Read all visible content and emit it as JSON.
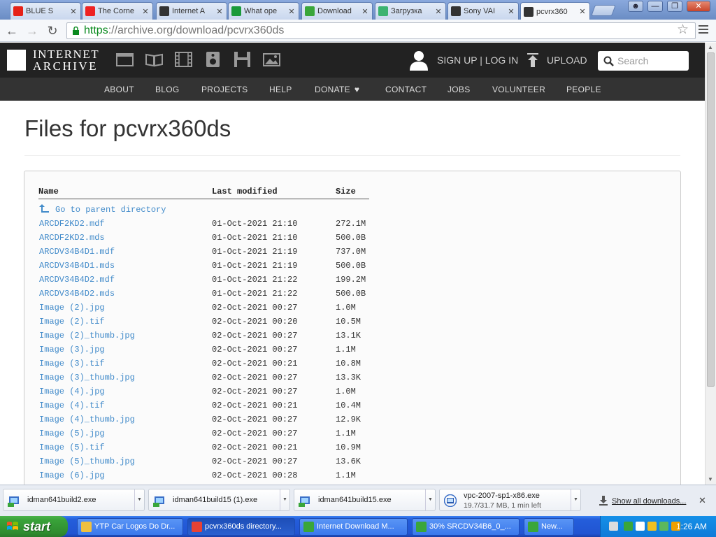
{
  "browser": {
    "tabs": [
      {
        "title": "BLUE S",
        "icon": "youtube-icon",
        "color": "#e62117"
      },
      {
        "title": "The Corne",
        "icon": "red-diamond-icon",
        "color": "#e22"
      },
      {
        "title": "Internet A",
        "icon": "archive-icon",
        "color": "#333"
      },
      {
        "title": "What ope",
        "icon": "green-play-icon",
        "color": "#1a9a3a"
      },
      {
        "title": "Download",
        "icon": "download-site-icon",
        "color": "#3aa63a"
      },
      {
        "title": "Загрузка",
        "icon": "shield-check-icon",
        "color": "#3cb371"
      },
      {
        "title": "Sony VAI",
        "icon": "archive-icon",
        "color": "#333"
      },
      {
        "title": "pcvrx360",
        "icon": "archive-icon",
        "color": "#333"
      }
    ],
    "url_scheme": "https",
    "url_rest": "://archive.org/download/pcvrx360ds"
  },
  "ia": {
    "logo_line1": "INTERNET",
    "logo_line2": "ARCHIVE",
    "signup": "SIGN UP | LOG IN",
    "upload": "UPLOAD",
    "search_placeholder": "Search",
    "nav": [
      "ABOUT",
      "BLOG",
      "PROJECTS",
      "HELP",
      "DONATE",
      "CONTACT",
      "JOBS",
      "VOLUNTEER",
      "PEOPLE"
    ]
  },
  "page": {
    "title": "Files for pcvrx360ds",
    "columns": {
      "name": "Name",
      "modified": "Last modified",
      "size": "Size"
    },
    "parent_link": "Go to parent directory",
    "files": [
      {
        "name": "ARCDF2KD2.mdf",
        "modified": "01-Oct-2021 21:10",
        "size": "272.1M"
      },
      {
        "name": "ARCDF2KD2.mds",
        "modified": "01-Oct-2021 21:10",
        "size": "500.0B"
      },
      {
        "name": "ARCDV34B4D1.mdf",
        "modified": "01-Oct-2021 21:19",
        "size": "737.0M"
      },
      {
        "name": "ARCDV34B4D1.mds",
        "modified": "01-Oct-2021 21:19",
        "size": "500.0B"
      },
      {
        "name": "ARCDV34B4D2.mdf",
        "modified": "01-Oct-2021 21:22",
        "size": "199.2M"
      },
      {
        "name": "ARCDV34B4D2.mds",
        "modified": "01-Oct-2021 21:22",
        "size": "500.0B"
      },
      {
        "name": "Image (2).jpg",
        "modified": "02-Oct-2021 00:27",
        "size": "1.0M"
      },
      {
        "name": "Image (2).tif",
        "modified": "02-Oct-2021 00:20",
        "size": "10.5M"
      },
      {
        "name": "Image (2)_thumb.jpg",
        "modified": "02-Oct-2021 00:27",
        "size": "13.1K"
      },
      {
        "name": "Image (3).jpg",
        "modified": "02-Oct-2021 00:27",
        "size": "1.1M"
      },
      {
        "name": "Image (3).tif",
        "modified": "02-Oct-2021 00:21",
        "size": "10.8M"
      },
      {
        "name": "Image (3)_thumb.jpg",
        "modified": "02-Oct-2021 00:27",
        "size": "13.3K"
      },
      {
        "name": "Image (4).jpg",
        "modified": "02-Oct-2021 00:27",
        "size": "1.0M"
      },
      {
        "name": "Image (4).tif",
        "modified": "02-Oct-2021 00:21",
        "size": "10.4M"
      },
      {
        "name": "Image (4)_thumb.jpg",
        "modified": "02-Oct-2021 00:27",
        "size": "12.9K"
      },
      {
        "name": "Image (5).jpg",
        "modified": "02-Oct-2021 00:27",
        "size": "1.1M"
      },
      {
        "name": "Image (5).tif",
        "modified": "02-Oct-2021 00:21",
        "size": "10.9M"
      },
      {
        "name": "Image (5)_thumb.jpg",
        "modified": "02-Oct-2021 00:27",
        "size": "13.6K"
      },
      {
        "name": "Image (6).jpg",
        "modified": "02-Oct-2021 00:28",
        "size": "1.1M"
      }
    ]
  },
  "downloads": {
    "items": [
      {
        "name": "idman641build2.exe"
      },
      {
        "name": "idman641build15 (1).exe"
      },
      {
        "name": "idman641build15.exe"
      },
      {
        "name": "vpc-2007-sp1-x86.exe",
        "status": "19.7/31.7 MB, 1 min left"
      }
    ],
    "show_all": "Show all downloads..."
  },
  "taskbar": {
    "start": "start",
    "buttons": [
      {
        "label": "YTP Car Logos Do Dr...",
        "icon": "folder-icon",
        "color": "#f0c040"
      },
      {
        "label": "pcvrx360ds directory...",
        "icon": "chrome-icon",
        "color": "#e94235"
      },
      {
        "label": "Internet Download M...",
        "icon": "idm-icon",
        "color": "#3aa63a"
      },
      {
        "label": "30% SRCDV34B6_0_...",
        "icon": "idm-icon",
        "color": "#3aa63a"
      },
      {
        "label": "New...",
        "icon": "idm-icon",
        "color": "#3aa63a"
      }
    ],
    "clock": "1:26 AM"
  }
}
